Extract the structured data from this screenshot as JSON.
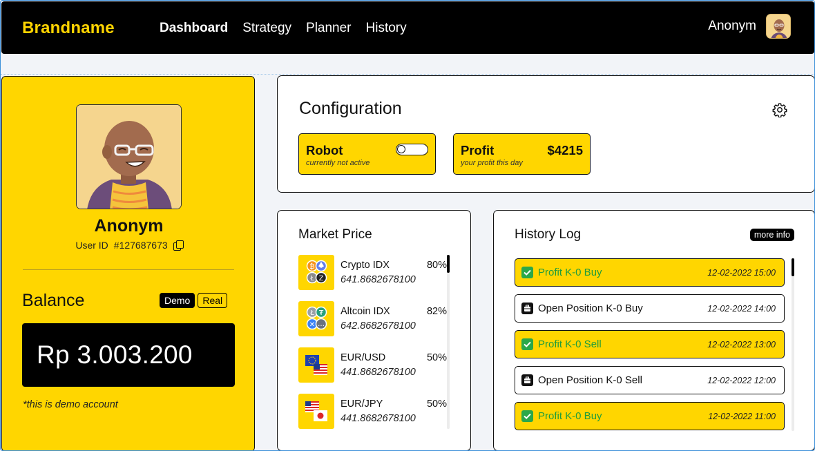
{
  "nav": {
    "brand": "Brandname",
    "items": [
      "Dashboard",
      "Strategy",
      "Planner",
      "History"
    ],
    "active": "Dashboard",
    "user_name": "Anonym"
  },
  "profile": {
    "name": "Anonym",
    "user_id_label": "User ID",
    "user_id": "#127687673",
    "balance_title": "Balance",
    "mode_demo": "Demo",
    "mode_real": "Real",
    "balance_value": "Rp 3.003.200",
    "demo_note": "*this is demo account"
  },
  "config": {
    "title": "Configuration",
    "robot": {
      "title": "Robot",
      "subtitle": "currently not active",
      "active": false
    },
    "profit": {
      "title": "Profit",
      "value": "$4215",
      "subtitle": "your profit this day"
    }
  },
  "market": {
    "title": "Market Price",
    "items": [
      {
        "name": "Crypto IDX",
        "pct": "80%",
        "price": "641.8682678100",
        "icon": "crypto-coins-icon"
      },
      {
        "name": "Altcoin IDX",
        "pct": "82%",
        "price": "642.8682678100",
        "icon": "altcoin-coins-icon"
      },
      {
        "name": "EUR/USD",
        "pct": "50%",
        "price": "441.8682678100",
        "icon": "eur-usd-flags-icon"
      },
      {
        "name": "EUR/JPY",
        "pct": "50%",
        "price": "441.8682678100",
        "icon": "eur-jpy-flags-icon"
      }
    ]
  },
  "history": {
    "title": "History Log",
    "more_info": "more info",
    "items": [
      {
        "label": "Profit K-0 Buy",
        "time": "12-02-2022 15:00",
        "type": "profit"
      },
      {
        "label": "Open Position K-0 Buy",
        "time": "12-02-2022 14:00",
        "type": "open"
      },
      {
        "label": "Profit K-0 Sell",
        "time": "12-02-2022 13:00",
        "type": "profit"
      },
      {
        "label": "Open Position K-0 Sell",
        "time": "12-02-2022 12:00",
        "type": "open"
      },
      {
        "label": "Profit K-0 Buy",
        "time": "12-02-2022 11:00",
        "type": "profit"
      }
    ]
  },
  "colors": {
    "accent": "#ffd600",
    "dark": "#000000",
    "success": "#1e9c3c"
  }
}
